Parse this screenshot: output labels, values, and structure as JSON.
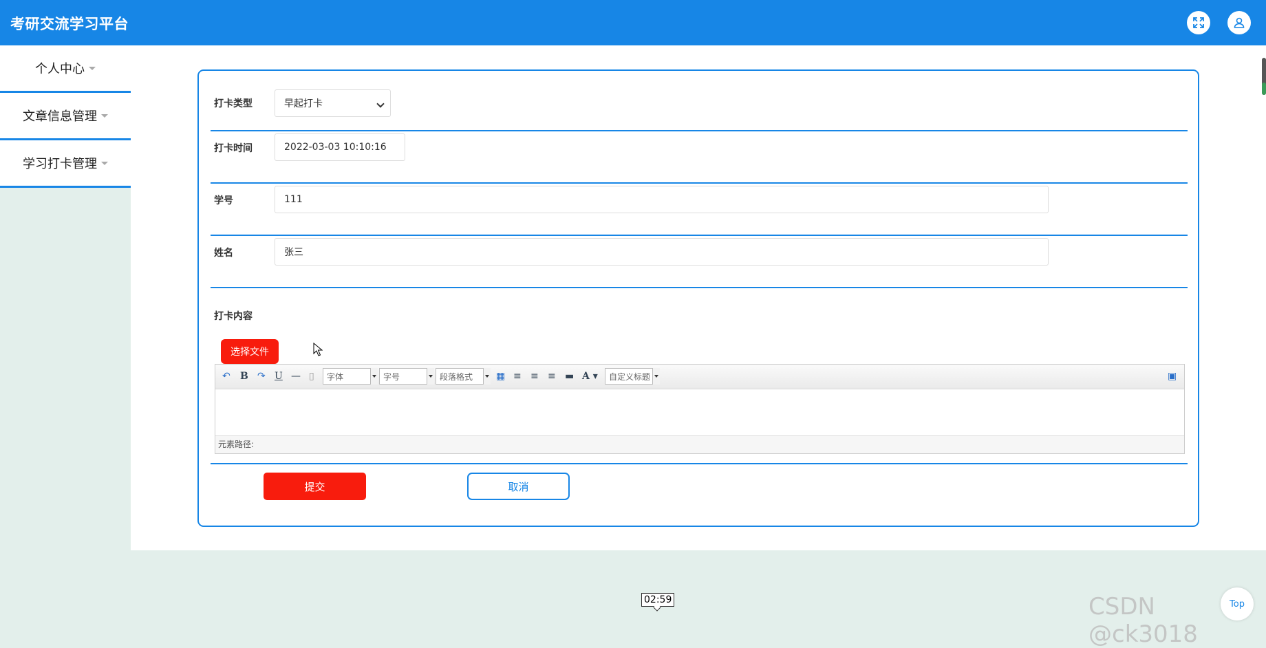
{
  "header": {
    "title": "考研交流学习平台",
    "fullscreen_icon": "expand-icon",
    "user_icon": "user-icon"
  },
  "sidebar": {
    "items": [
      {
        "label": "个人中心"
      },
      {
        "label": "文章信息管理"
      },
      {
        "label": "学习打卡管理"
      }
    ]
  },
  "form": {
    "type_label": "打卡类型",
    "type_value": "早起打卡",
    "time_label": "打卡时间",
    "time_value": "2022-03-03 10:10:16",
    "student_id_label": "学号",
    "student_id_value": "111",
    "name_label": "姓名",
    "name_value": "张三",
    "content_label": "打卡内容",
    "file_button": "选择文件",
    "editor": {
      "font_label": "字体",
      "size_label": "字号",
      "paragraph_label": "段落格式",
      "custom_title_label": "自定义标题",
      "status_text": "元素路径:"
    },
    "submit_label": "提交",
    "cancel_label": "取消"
  },
  "overlay": {
    "timer": "02:59",
    "top_button": "Top",
    "watermark": "CSDN @ck3018"
  },
  "colors": {
    "primary": "#1786e6",
    "danger": "#f81c0d",
    "background": "#e3efeb"
  }
}
